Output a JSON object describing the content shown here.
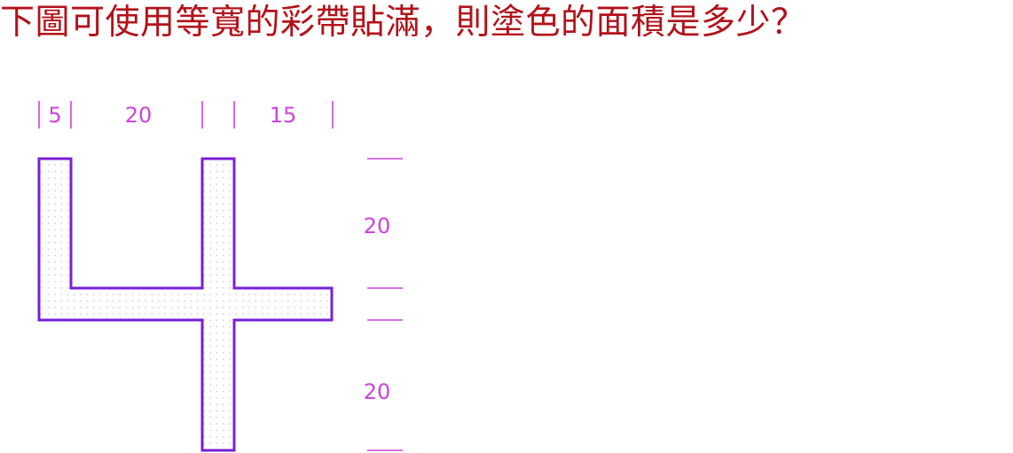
{
  "question": "下圖可使用等寬的彩帶貼滿，則塗色的面積是多少？",
  "colors": {
    "question_text": "#b3121a",
    "dimension": "#cc44dd",
    "outline": "#7a1fd6",
    "fill_dots": "#c8c8c8"
  },
  "figure": {
    "dimensions_top": {
      "a": "5",
      "b": "20",
      "c": "15"
    },
    "dimensions_right": {
      "upper": "20",
      "lower": "20"
    }
  }
}
